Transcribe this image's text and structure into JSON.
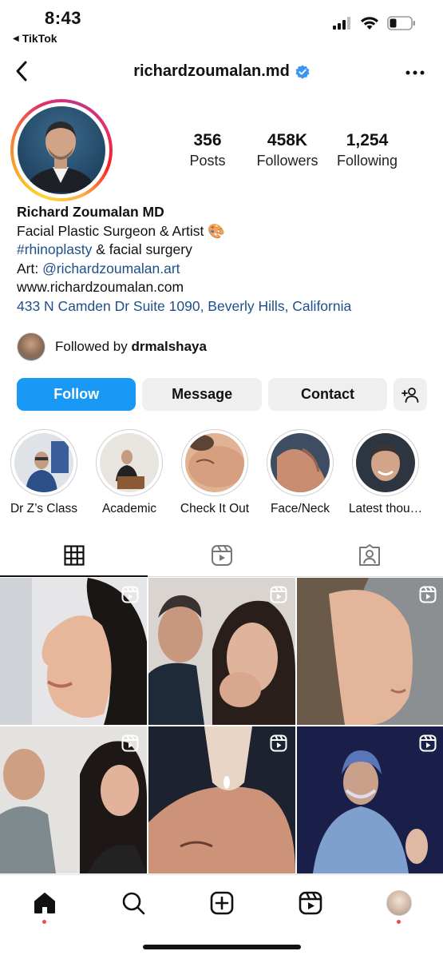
{
  "status_bar": {
    "time": "8:43",
    "back_app": "TikTok"
  },
  "header": {
    "username": "richardzoumalan.md",
    "verified": true
  },
  "stats": [
    {
      "value": "356",
      "label": "Posts"
    },
    {
      "value": "458K",
      "label": "Followers"
    },
    {
      "value": "1,254",
      "label": "Following"
    }
  ],
  "bio": {
    "name": "Richard Zoumalan MD",
    "line1": "Facial Plastic Surgeon & Artist 🎨",
    "hashtag": "#rhinoplasty",
    "line2_rest": " & facial surgery",
    "art_prefix": "Art: ",
    "art_handle": "@richardzoumalan.art",
    "website": "www.richardzoumalan.com",
    "address": "433 N Camden Dr  Suite 1090, Beverly Hills, California"
  },
  "followed_by": {
    "prefix": "Followed by ",
    "user": "drmalshaya"
  },
  "buttons": {
    "follow": "Follow",
    "message": "Message",
    "contact": "Contact"
  },
  "highlights": [
    {
      "label": "Dr Z’s Class"
    },
    {
      "label": "Academic"
    },
    {
      "label": "Check It Out"
    },
    {
      "label": "Face/Neck"
    },
    {
      "label": "Latest thou…"
    }
  ],
  "colors": {
    "follow_blue": "#1a98f5",
    "link_blue": "#1f4f8a",
    "verified_blue": "#3897f0",
    "notification_red": "#ed4956"
  }
}
